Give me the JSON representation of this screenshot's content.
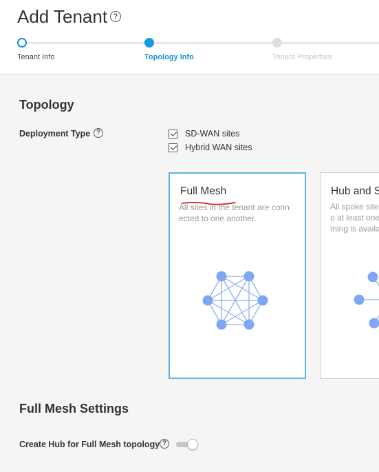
{
  "page": {
    "title": "Add Tenant"
  },
  "stepper": {
    "steps": [
      {
        "label": "Tenant Info",
        "state": "completed"
      },
      {
        "label": "Topology Info",
        "state": "active"
      },
      {
        "label": "Tenant Properties",
        "state": "pending"
      }
    ]
  },
  "topology": {
    "section_title": "Topology",
    "deployment_type": {
      "label": "Deployment Type",
      "options": [
        {
          "label": "SD-WAN sites",
          "checked": true
        },
        {
          "label": "Hybrid WAN sites",
          "checked": true
        }
      ]
    },
    "cards": [
      {
        "title": "Full Mesh",
        "desc_line1": "All sites in the tenant are conn",
        "desc_line2": "ected to one another.",
        "selected": true
      },
      {
        "title": "Hub and S",
        "desc_line1": "All spoke site",
        "desc_line2": "o at least one",
        "desc_line3": "ming is availa",
        "selected": false
      }
    ]
  },
  "settings": {
    "section_title": "Full Mesh Settings",
    "create_hub": {
      "label": "Create Hub for Full Mesh topology",
      "enabled": false
    }
  },
  "colors": {
    "accent": "#1a9ae5",
    "selected_card_border": "#5cb3e8",
    "diagram_node": "#7ea6f2",
    "diagram_edge": "#8fb0f0",
    "annotation_underline": "#d61f1f"
  },
  "icons": [
    "help-icon",
    "checkbox-checked-icon",
    "full-mesh-diagram",
    "hub-spoke-diagram",
    "red-underline-annotation"
  ]
}
